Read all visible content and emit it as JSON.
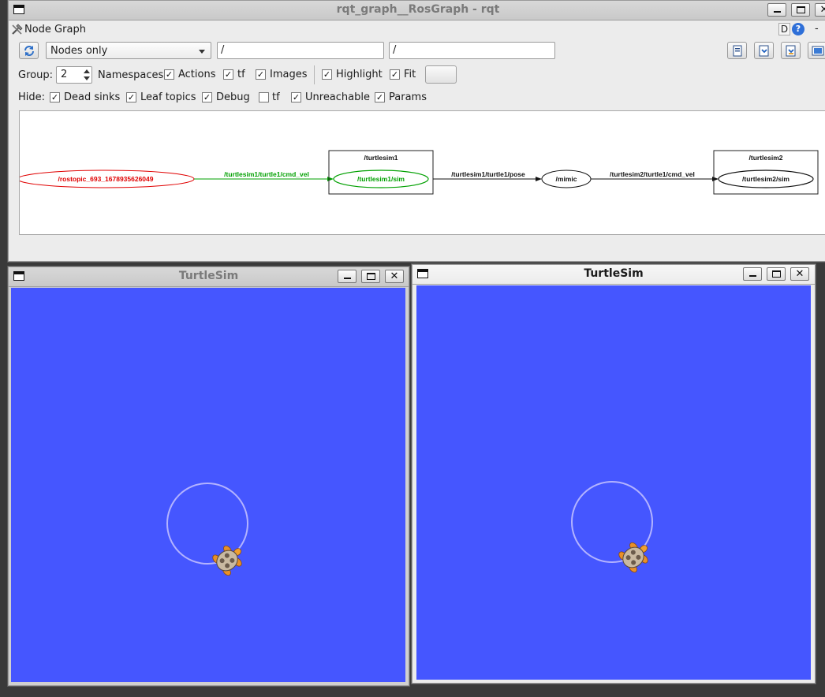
{
  "rqt": {
    "window_title": "rqt_graph__RosGraph - rqt",
    "plugin_title": "Node Graph",
    "plugin_buttons": {
      "d_label": "D",
      "help_label": "?",
      "dash_label": "-"
    },
    "filter_mode": "Nodes only",
    "namespace_filter": "/",
    "topic_filter": "/",
    "group_label": "Group:",
    "group_value": "2",
    "namespaces_label": "Namespaces",
    "options": {
      "actions": {
        "label": "Actions",
        "checked": true
      },
      "tf": {
        "label": "tf",
        "checked": true
      },
      "images": {
        "label": "Images",
        "checked": true
      },
      "highlight": {
        "label": "Highlight",
        "checked": true
      },
      "fit": {
        "label": "Fit",
        "checked": true
      }
    },
    "hide_label": "Hide:",
    "hide": {
      "dead_sinks": {
        "label": "Dead sinks",
        "checked": true
      },
      "leaf_topics": {
        "label": "Leaf topics",
        "checked": true
      },
      "debug": {
        "label": "Debug",
        "checked": true
      },
      "tf": {
        "label": "tf",
        "checked": false
      },
      "unreachable": {
        "label": "Unreachable",
        "checked": true
      },
      "params": {
        "label": "Params",
        "checked": true
      }
    },
    "graph": {
      "topic_node": "/rostopic_693_1678935626049",
      "edge1": "/turtlesim1/turtle1/cmd_vel",
      "group1": "/turtlesim1",
      "node1": "/turtlesim1/sim",
      "edge2": "/turtlesim1/turtle1/pose",
      "mimic": "/mimic",
      "edge3": "/turtlesim2/turtle1/cmd_vel",
      "group2": "/turtlesim2",
      "node2": "/turtlesim2/sim",
      "colors": {
        "highlight_red": "#e00000",
        "highlight_green": "#00a000"
      }
    }
  },
  "turtlesim_left": {
    "window_title": "TurtleSim",
    "background": "#4556ff"
  },
  "turtlesim_right": {
    "window_title": "TurtleSim",
    "background": "#4556ff"
  }
}
